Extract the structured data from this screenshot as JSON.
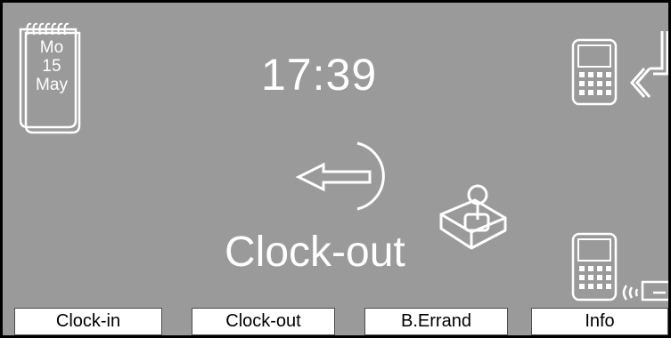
{
  "date": {
    "weekday": "Mo",
    "day": "15",
    "month": "May"
  },
  "clock": {
    "time": "17:39"
  },
  "status": {
    "mode_label": "Clock-out"
  },
  "softkeys": [
    {
      "label": "Clock-in"
    },
    {
      "label": "Clock-out"
    },
    {
      "label": "B.Errand"
    },
    {
      "label": "Info"
    }
  ],
  "icons": {
    "calendar": "calendar-icon",
    "direction": "left-arrow-icon",
    "joystick": "joystick-icon",
    "terminal_top": "terminal-login-icon",
    "terminal_bottom": "terminal-card-reader-icon"
  },
  "colors": {
    "screen_bg": "#9a9a9a",
    "foreground": "#ffffff",
    "key_bg": "#ffffff"
  }
}
